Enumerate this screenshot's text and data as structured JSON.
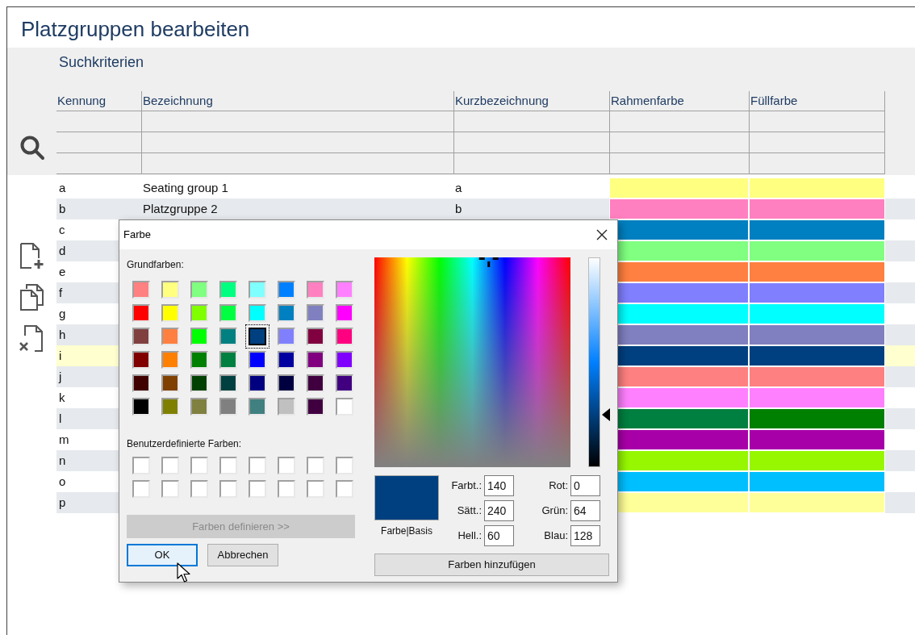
{
  "window": {
    "title": "Platzgruppen bearbeiten"
  },
  "search": {
    "title": "Suchkriterien",
    "columns": [
      "Kennung",
      "Bezeichnung",
      "Kurzbezeichnung",
      "Rahmenfarbe",
      "Füllfarbe"
    ]
  },
  "rows": [
    {
      "kennung": "a",
      "bezeichnung": "Seating group 1",
      "kurzbezeichnung": "a",
      "frame": {
        "color": "#ffff80"
      },
      "fill": {
        "color": "#ffff80"
      },
      "selected": false
    },
    {
      "kennung": "b",
      "bezeichnung": "Platzgruppe 2",
      "kurzbezeichnung": "b",
      "frame": {
        "color": "#ff80c0"
      },
      "fill": {
        "color": "#ff80c0"
      },
      "selected": false
    },
    {
      "kennung": "c",
      "frame": {
        "color": "#0080c0"
      },
      "fill": {
        "color": "#0080c0"
      },
      "selected": false
    },
    {
      "kennung": "d",
      "frame": {
        "color": "#80ff80"
      },
      "fill": {
        "color": "#80ff80"
      },
      "selected": false
    },
    {
      "kennung": "e",
      "frame": {
        "color": "#ff8040"
      },
      "fill": {
        "color": "#ff8040"
      },
      "selected": false
    },
    {
      "kennung": "f",
      "frame": {
        "color": "#8080ff"
      },
      "fill": {
        "color": "#8080ff"
      },
      "selected": false
    },
    {
      "kennung": "g",
      "frame": {
        "color": "#00ffff"
      },
      "fill": {
        "color": "#00ffff"
      },
      "selected": false
    },
    {
      "kennung": "h",
      "frame": {
        "color": "#8080c0"
      },
      "fill": {
        "color": "#8080c0"
      },
      "selected": false
    },
    {
      "kennung": "i",
      "frame": {
        "color": "#004080"
      },
      "fill": {
        "color": "#004080"
      },
      "selected": true
    },
    {
      "kennung": "j",
      "frame": {
        "color": "#ff8080"
      },
      "fill": {
        "color": "#ff8080"
      },
      "selected": false
    },
    {
      "kennung": "k",
      "frame": {
        "color": "#ff80ff"
      },
      "fill": {
        "color": "#ff80ff"
      },
      "selected": false
    },
    {
      "kennung": "l",
      "frame": {
        "color": "#008040"
      },
      "fill": {
        "color": "#008000"
      },
      "selected": false
    },
    {
      "kennung": "m",
      "frame": {
        "color": "#a800a8"
      },
      "fill": {
        "color": "#a800a8"
      },
      "selected": false
    },
    {
      "kennung": "n",
      "frame": {
        "color": "#96f700"
      },
      "fill": {
        "color": "#96f700"
      },
      "selected": false
    },
    {
      "kennung": "o",
      "frame": {
        "color": "#00bfff"
      },
      "fill": {
        "color": "#00bfff"
      },
      "selected": false
    },
    {
      "kennung": "p",
      "frame": {
        "color": "#ffff99"
      },
      "fill": {
        "color": "#ffff99"
      },
      "selected": false
    }
  ],
  "dialog": {
    "title": "Farbe",
    "basic_colors_label": "Grundfarben:",
    "basic_colors": [
      {
        "color": "#ff8080",
        "selected": false
      },
      {
        "color": "#ffff80",
        "selected": false
      },
      {
        "color": "#80ff80",
        "selected": false
      },
      {
        "color": "#00ff80",
        "selected": false
      },
      {
        "color": "#80ffff",
        "selected": false
      },
      {
        "color": "#0080ff",
        "selected": false
      },
      {
        "color": "#ff80c0",
        "selected": false
      },
      {
        "color": "#ff80ff",
        "selected": false
      },
      {
        "color": "#ff0000",
        "selected": false
      },
      {
        "color": "#ffff00",
        "selected": false
      },
      {
        "color": "#80ff00",
        "selected": false
      },
      {
        "color": "#00ff40",
        "selected": false
      },
      {
        "color": "#00ffff",
        "selected": false
      },
      {
        "color": "#0080c0",
        "selected": false
      },
      {
        "color": "#8080c0",
        "selected": false
      },
      {
        "color": "#ff00ff",
        "selected": false
      },
      {
        "color": "#804040",
        "selected": false
      },
      {
        "color": "#ff8040",
        "selected": false
      },
      {
        "color": "#00ff00",
        "selected": false
      },
      {
        "color": "#008080",
        "selected": false
      },
      {
        "color": "#004080",
        "selected": true
      },
      {
        "color": "#8080ff",
        "selected": false
      },
      {
        "color": "#800040",
        "selected": false
      },
      {
        "color": "#ff0080",
        "selected": false
      },
      {
        "color": "#800000",
        "selected": false
      },
      {
        "color": "#ff8000",
        "selected": false
      },
      {
        "color": "#008000",
        "selected": false
      },
      {
        "color": "#008040",
        "selected": false
      },
      {
        "color": "#0000ff",
        "selected": false
      },
      {
        "color": "#0000a0",
        "selected": false
      },
      {
        "color": "#800080",
        "selected": false
      },
      {
        "color": "#8000ff",
        "selected": false
      },
      {
        "color": "#400000",
        "selected": false
      },
      {
        "color": "#804000",
        "selected": false
      },
      {
        "color": "#004000",
        "selected": false
      },
      {
        "color": "#004040",
        "selected": false
      },
      {
        "color": "#000080",
        "selected": false
      },
      {
        "color": "#000040",
        "selected": false
      },
      {
        "color": "#400040",
        "selected": false
      },
      {
        "color": "#400080",
        "selected": false
      },
      {
        "color": "#000000",
        "selected": false
      },
      {
        "color": "#808000",
        "selected": false
      },
      {
        "color": "#808040",
        "selected": false
      },
      {
        "color": "#808080",
        "selected": false
      },
      {
        "color": "#408080",
        "selected": false
      },
      {
        "color": "#c0c0c0",
        "selected": false
      },
      {
        "color": "#400040",
        "selected": false
      },
      {
        "color": "#ffffff",
        "selected": false
      }
    ],
    "custom_colors_label": "Benutzerdefinierte Farben:",
    "custom_colors": [
      {
        "color": "#ffffff"
      },
      {
        "color": "#ffffff"
      },
      {
        "color": "#ffffff"
      },
      {
        "color": "#ffffff"
      },
      {
        "color": "#ffffff"
      },
      {
        "color": "#ffffff"
      },
      {
        "color": "#ffffff"
      },
      {
        "color": "#ffffff"
      },
      {
        "color": "#ffffff"
      },
      {
        "color": "#ffffff"
      },
      {
        "color": "#ffffff"
      },
      {
        "color": "#ffffff"
      },
      {
        "color": "#ffffff"
      },
      {
        "color": "#ffffff"
      },
      {
        "color": "#ffffff"
      },
      {
        "color": "#ffffff"
      }
    ],
    "define_button": {
      "label": "Farben definieren >>",
      "disabled": true
    },
    "ok_button": {
      "label": "OK",
      "focused": true
    },
    "cancel_button": {
      "label": "Abbrechen",
      "focused": false
    },
    "preview": {
      "color": "#004080",
      "label": "Farbe|Basis"
    },
    "hsl_fields": [
      {
        "label": "Farbt.:",
        "value": "140"
      },
      {
        "label": "Sätt.:",
        "value": "240"
      },
      {
        "label": "Hell.:",
        "value": "60"
      }
    ],
    "rgb_fields": [
      {
        "label": "Rot:",
        "value": "0"
      },
      {
        "label": "Grün:",
        "value": "64"
      },
      {
        "label": "Blau:",
        "value": "128"
      }
    ],
    "add_button": {
      "label": "Farben hinzufügen"
    }
  }
}
